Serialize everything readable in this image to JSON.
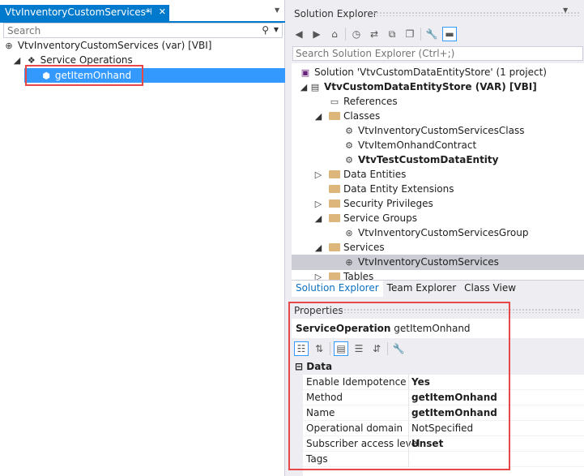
{
  "left_pane": {
    "tab_title": "VtvInventoryCustomServices*",
    "search_placeholder": "Search",
    "tree": [
      {
        "label": "VtvInventoryCustomServices (var) [VBI]"
      },
      {
        "label": "Service Operations"
      },
      {
        "label": "getItemOnhand"
      }
    ]
  },
  "solution_explorer": {
    "title": "Solution Explorer",
    "search_placeholder": "Search Solution Explorer (Ctrl+;)",
    "tree": [
      {
        "label": "Solution 'VtvCustomDataEntityStore' (1 project)"
      },
      {
        "label": "VtvCustomDataEntityStore (VAR) [VBI]"
      },
      {
        "label": "References"
      },
      {
        "label": "Classes"
      },
      {
        "label": "VtvInventoryCustomServicesClass"
      },
      {
        "label": "VtvItemOnhandContract"
      },
      {
        "label": "VtvTestCustomDataEntity"
      },
      {
        "label": "Data Entities"
      },
      {
        "label": "Data Entity Extensions"
      },
      {
        "label": "Security Privileges"
      },
      {
        "label": "Service Groups"
      },
      {
        "label": "VtvInventoryCustomServicesGroup"
      },
      {
        "label": "Services"
      },
      {
        "label": "VtvInventoryCustomServices"
      },
      {
        "label": "Tables"
      }
    ],
    "tabs": [
      "Solution Explorer",
      "Team Explorer",
      "Class View"
    ]
  },
  "properties": {
    "title": "Properties",
    "object_type": "ServiceOperation",
    "object_name": "getItemOnhand",
    "category": "Data",
    "rows": [
      {
        "key": "Enable Idempotence",
        "value": "Yes"
      },
      {
        "key": "Method",
        "value": "getItemOnhand"
      },
      {
        "key": "Name",
        "value": "getItemOnhand"
      },
      {
        "key": "Operational domain",
        "value": "NotSpecified"
      },
      {
        "key": "Subscriber access level",
        "value": "Unset"
      },
      {
        "key": "Tags",
        "value": ""
      }
    ]
  },
  "colors": {
    "accent": "#007acc",
    "selection": "#3399ff",
    "highlight_border": "#e8474a",
    "folder": "#dcb67a"
  }
}
